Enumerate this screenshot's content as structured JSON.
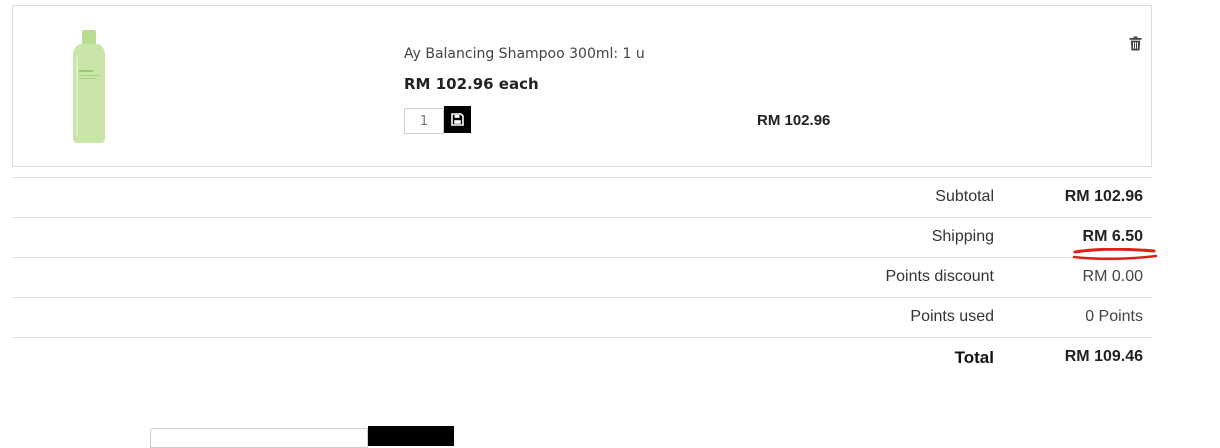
{
  "cart_item": {
    "product_name": "Ay Balancing Shampoo 300ml: 1 u",
    "unit_price": "RM 102.96 each",
    "quantity": "1",
    "line_total": "RM 102.96",
    "image_icon": "shampoo-bottle",
    "save_icon": "floppy-disk-icon",
    "delete_icon": "trash-icon"
  },
  "totals": {
    "subtotal_label": "Subtotal",
    "subtotal_value": "RM 102.96",
    "shipping_label": "Shipping",
    "shipping_value": "RM 6.50",
    "points_discount_label": "Points discount",
    "points_discount_value": "RM 0.00",
    "points_used_label": "Points used",
    "points_used_value": "0 Points",
    "total_label": "Total",
    "total_value": "RM 109.46"
  },
  "colors": {
    "annotation": "#e0201b",
    "bottle": "#c9e6a8",
    "button": "#000000"
  }
}
